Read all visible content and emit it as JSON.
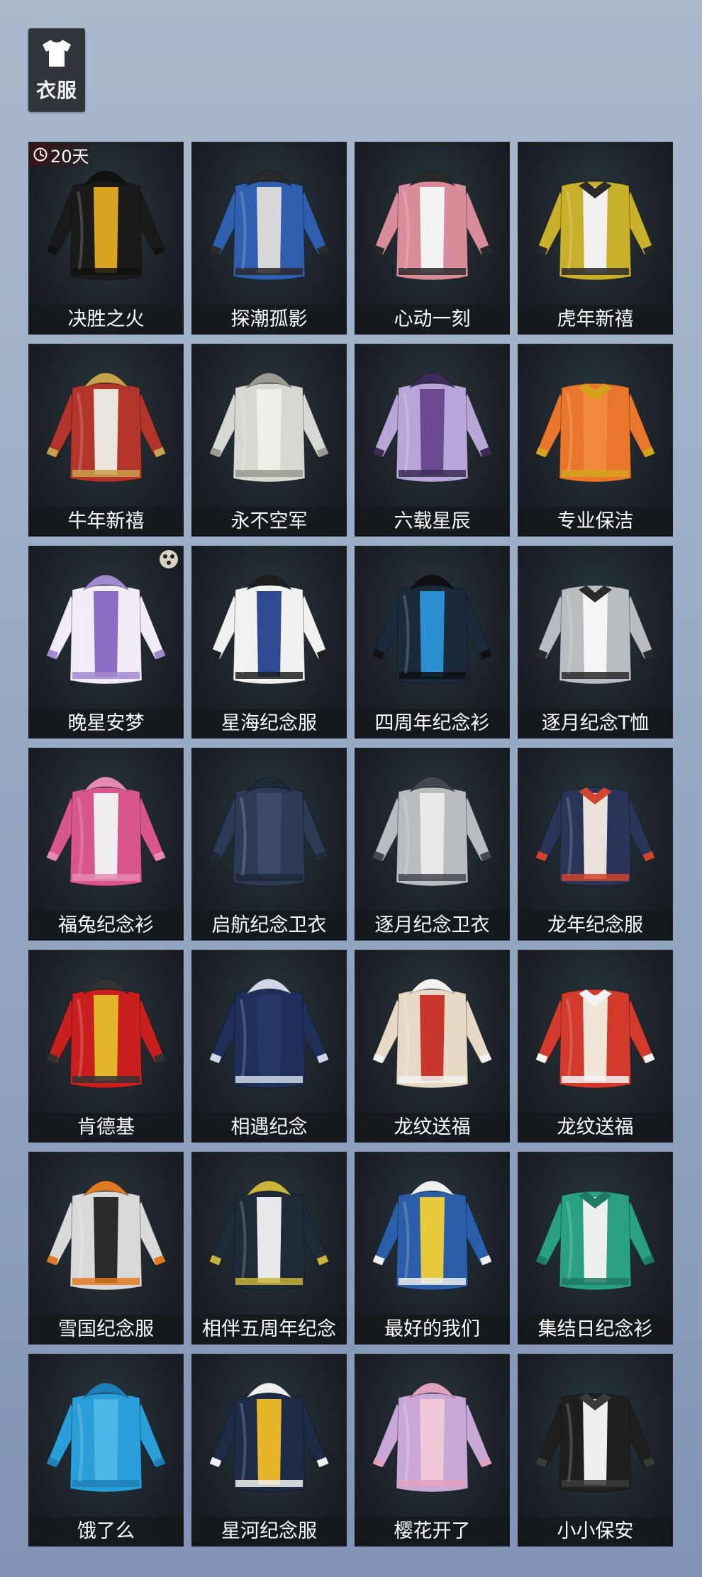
{
  "category": {
    "label": "衣服",
    "icon": "tshirt-icon"
  },
  "items": [
    {
      "name": "决胜之火",
      "badge": "20天",
      "colors": [
        "#1a1a1a",
        "#d9a520",
        "#111111"
      ]
    },
    {
      "name": "探潮孤影",
      "colors": [
        "#2f5fae",
        "#d8d8d8",
        "#2a2a2a"
      ]
    },
    {
      "name": "心动一刻",
      "colors": [
        "#d98c99",
        "#f2f2f2",
        "#2a2a2a"
      ]
    },
    {
      "name": "虎年新禧",
      "colors": [
        "#c8b02a",
        "#f0f0f0",
        "#2a2a2a"
      ]
    },
    {
      "name": "牛年新禧",
      "colors": [
        "#b2342b",
        "#e9e4dc",
        "#c9a04b"
      ]
    },
    {
      "name": "永不空军",
      "colors": [
        "#d8d8d2",
        "#efefea",
        "#9a9a90"
      ]
    },
    {
      "name": "六载星辰",
      "colors": [
        "#b9a6d8",
        "#6b4a8f",
        "#3a2c55"
      ]
    },
    {
      "name": "专业保洁",
      "colors": [
        "#e9762a",
        "#f08a3a",
        "#d4a31c"
      ]
    },
    {
      "name": "晚星安梦",
      "colors": [
        "#f1ecf6",
        "#8d6cc4",
        "#a08bd0"
      ]
    },
    {
      "name": "星海纪念服",
      "colors": [
        "#f1f1f1",
        "#2f4a90",
        "#1f1f1f"
      ]
    },
    {
      "name": "四周年纪念衫",
      "colors": [
        "#1a2a3a",
        "#2a8fd0",
        "#101010"
      ]
    },
    {
      "name": "逐月纪念T恤",
      "colors": [
        "#b9bcc0",
        "#f4f4f4",
        "#2a2a2a"
      ]
    },
    {
      "name": "福兔纪念衫",
      "colors": [
        "#d9568c",
        "#f1eef0",
        "#e58ab0"
      ]
    },
    {
      "name": "启航纪念卫衣",
      "colors": [
        "#2c3a55",
        "#3b4a66",
        "#1e2838"
      ]
    },
    {
      "name": "逐月纪念卫衣",
      "colors": [
        "#b9bcc0",
        "#e9e9e9",
        "#44484e"
      ]
    },
    {
      "name": "龙年纪念服",
      "colors": [
        "#2a3358",
        "#e9e2dc",
        "#d0452b"
      ]
    },
    {
      "name": "肯德基",
      "colors": [
        "#c9201f",
        "#e3b52a",
        "#333333"
      ]
    },
    {
      "name": "相遇纪念",
      "colors": [
        "#1f2f5a",
        "#243766",
        "#d0d8e8"
      ]
    },
    {
      "name": "龙纹送福",
      "colors": [
        "#e7d9c6",
        "#c9372c",
        "#f2f2f2"
      ]
    },
    {
      "name": "龙纹送福",
      "colors": [
        "#d43a2b",
        "#f0e6d8",
        "#f4f4f4"
      ]
    },
    {
      "name": "雪国纪念服",
      "colors": [
        "#d9d9d9",
        "#2a2a2a",
        "#e07a20"
      ]
    },
    {
      "name": "相伴五周年纪念",
      "colors": [
        "#1f2a38",
        "#e8e8e8",
        "#c9b43a"
      ]
    },
    {
      "name": "最好的我们",
      "colors": [
        "#2a5ea8",
        "#e7c93a",
        "#efefef"
      ]
    },
    {
      "name": "集结日纪念衫",
      "colors": [
        "#2aa083",
        "#efefef",
        "#1d7a63"
      ]
    },
    {
      "name": "饿了么",
      "colors": [
        "#2a9ed8",
        "#4bb6e8",
        "#1e7fb8"
      ]
    },
    {
      "name": "星河纪念服",
      "colors": [
        "#1f2a45",
        "#e7b52a",
        "#f0f0f0"
      ]
    },
    {
      "name": "樱花开了",
      "colors": [
        "#c9a8d8",
        "#f0c8d8",
        "#e0a0c0"
      ]
    },
    {
      "name": "小小保安",
      "colors": [
        "#1f1f1f",
        "#efefef",
        "#3a3a3a"
      ]
    }
  ]
}
